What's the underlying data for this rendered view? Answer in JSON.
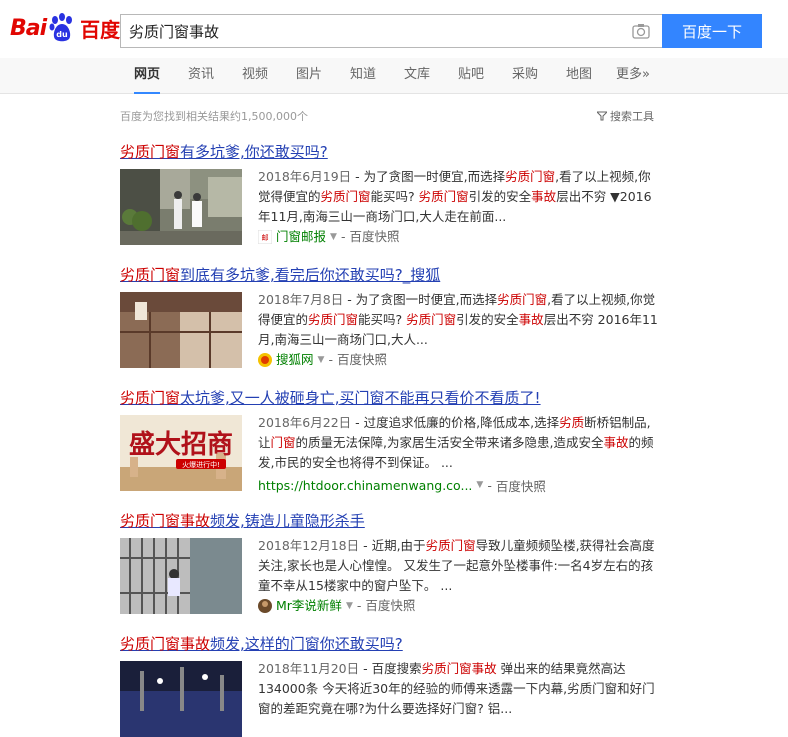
{
  "logo": {
    "text_latin": "Bai",
    "text_du": "du",
    "text_zh": "百度"
  },
  "search": {
    "query": "劣质门窗事故",
    "button_label": "百度一下"
  },
  "nav_tabs": [
    "网页",
    "资讯",
    "视频",
    "图片",
    "知道",
    "文库",
    "贴吧",
    "采购",
    "地图",
    "更多»"
  ],
  "result_count": "百度为您找到相关结果约1,500,000个",
  "search_tools_label": "搜索工具",
  "results": [
    {
      "title_em": "劣质门窗",
      "title_rest": "有多坑爹,你还敢买吗?",
      "date": "2018年6月19日",
      "snippet_html": " - 为了贪图一时便宜,而选择<em>劣质门窗</em>,看了以上视频,你觉得便宜的<em>劣质门窗</em>能买吗? <em>劣质门窗</em>引发的安全<em>事故</em>层出不穷 ▼2016年11月,南海三山一商场门口,大人走在前面...",
      "source": "门窗邮报",
      "kuaizhao": "百度快照"
    },
    {
      "title_em": "劣质门窗",
      "title_rest": "到底有多坑爹,看完后你还敢买吗?_搜狐",
      "date": "2018年7月8日",
      "snippet_html": " - 为了贪图一时便宜,而选择<em>劣质门窗</em>,看了以上视频,你觉得便宜的<em>劣质门窗</em>能买吗? <em>劣质门窗</em>引发的安全<em>事故</em>层出不穷 2016年11月,南海三山一商场门口,大人...",
      "source": "搜狐网",
      "kuaizhao": "百度快照"
    },
    {
      "title_em": "劣质门窗",
      "title_rest": "太坑爹,又一人被砸身亡,买门窗不能再只看价不看质了!",
      "date": "2018年6月22日",
      "snippet_html": " - 过度追求低廉的价格,降低成本,选择<em>劣质</em>断桥铝制品,让<em>门窗</em>的质量无法保障,为家居生活安全带来诸多隐患,造成安全<em>事故</em>的频发,市民的安全也将得不到保证。 ...",
      "source": "https://htdoor.chinamenwang.co...",
      "kuaizhao": "百度快照",
      "thumb_text": "盛大招商",
      "thumb_sub": "火爆进行中!"
    },
    {
      "title_em": "劣质门窗事故",
      "title_rest": "频发,铸造儿童隐形杀手",
      "date": "2018年12月18日",
      "snippet_html": " - 近期,由于<em>劣质门窗</em>导致儿童频频坠楼,获得社会高度关注,家长也是人心惶惶。 又发生了一起意外坠楼事件:一名4岁左右的孩童不幸从15楼家中的窗户坠下。 ...",
      "source": "Mr李说新鲜",
      "kuaizhao": "百度快照"
    },
    {
      "title_em": "劣质门窗事故",
      "title_rest": "频发,这样的门窗你还敢买吗?",
      "date": "2018年11月20日",
      "snippet_html": " - 百度搜索<em>劣质门窗事故</em> 弹出来的结果竟然高达134000条 今天将近30年的经验的师傅来透露一下内幕,劣质门窗和好门窗的差距究竟在哪?为什么要选择好门窗? 铝...",
      "source": "",
      "kuaizhao": ""
    }
  ]
}
